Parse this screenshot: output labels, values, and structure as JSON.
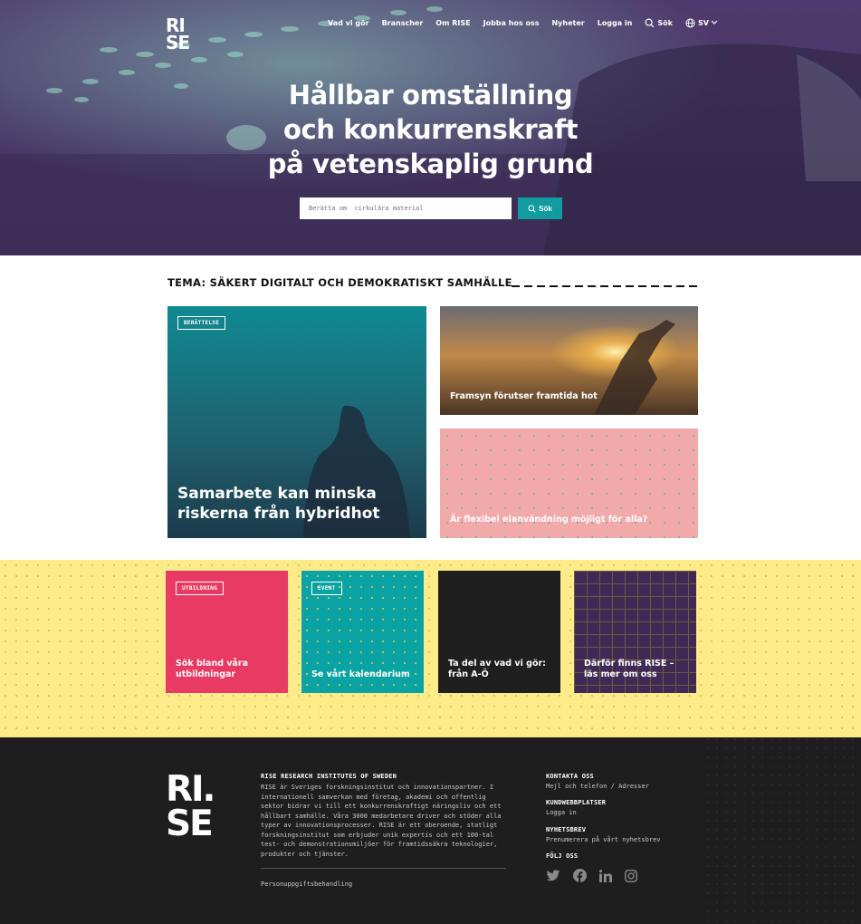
{
  "brand": {
    "logo_line1": "RI",
    "logo_line2": "SE",
    "logo_dot": "."
  },
  "nav": {
    "items": [
      "Vad vi gör",
      "Branscher",
      "Om RISE",
      "Jobba hos oss",
      "Nyheter",
      "Logga in"
    ],
    "search_label": "Sök",
    "language": "SV",
    "icons": {
      "search": "search-icon",
      "globe": "globe-icon",
      "chevron": "chevron-down-icon"
    }
  },
  "hero": {
    "title_line1": "Hållbar omställning",
    "title_line2": "och konkurrenskraft",
    "title_line3": "på vetenskaplig grund",
    "search_placeholder": "Berätta om  cirkulära material",
    "search_button": "Sök"
  },
  "theme": {
    "title": "TEMA: SÄKERT DIGITALT OCH DEMOKRATISKT SAMHÄLLE",
    "cards": [
      {
        "tag": "BERÄTTELSE",
        "title_line1": "Samarbete kan minska",
        "title_line2": "riskerna från hybridhot"
      },
      {
        "title": "Framsyn förutser framtida hot"
      },
      {
        "title": "Är flexibel elanvändning möjligt för alla?"
      }
    ]
  },
  "tiles": [
    {
      "tag": "UTBILDNING",
      "title": "Sök bland våra utbildningar",
      "color": "#e83a62"
    },
    {
      "tag": "EVENT",
      "title": "Se vårt kalendarium",
      "color": "#0aa3a3"
    },
    {
      "title": "Ta del av vad vi gör: från A-Ö",
      "color": "#1f1f1f"
    },
    {
      "title": "Därför finns RISE – läs mer om oss",
      "color": "#3f2a56"
    }
  ],
  "footer": {
    "logo_line1": "RI.",
    "logo_line2": "SE",
    "org_title": "RISE RESEARCH INSTITUTES OF SWEDEN",
    "org_text": "RISE är Sveriges forskningsinstitut och innovationspartner. I internationell samverkan med företag, akademi och offentlig sektor bidrar vi till ett konkurrenskraftigt näringsliv och ett hållbart samhälle. Våra 3000 medarbetare driver och stöder alla typer av innovationsprocesser. RISE är ett oberoende, statligt forskningsinstitut som erbjuder unik expertis och ett 100-tal test- och demonstrationsmiljöer för framtidssäkra teknologier, produkter och tjänster.",
    "privacy": "Personuppgiftsbehandling",
    "contact_head": "KONTAKTA OSS",
    "contact_link": "Mejl och telefon / Adresser",
    "customer_head": "KUNDWEBBPLATSER",
    "customer_link": "Logga in",
    "newsletter_head": "NYHETSBREV",
    "newsletter_link": "Prenumerera på vårt nyhetsbrev",
    "follow_head": "FÖLJ OSS",
    "social_icons": [
      "twitter-icon",
      "facebook-icon",
      "linkedin-icon",
      "instagram-icon"
    ]
  },
  "colors": {
    "hero_purple": "#4b3665",
    "accent_teal": "#129ba0",
    "yellow": "#fdeb8a",
    "pink_card": "#f2a9aa",
    "footer": "#1e1e1e"
  }
}
